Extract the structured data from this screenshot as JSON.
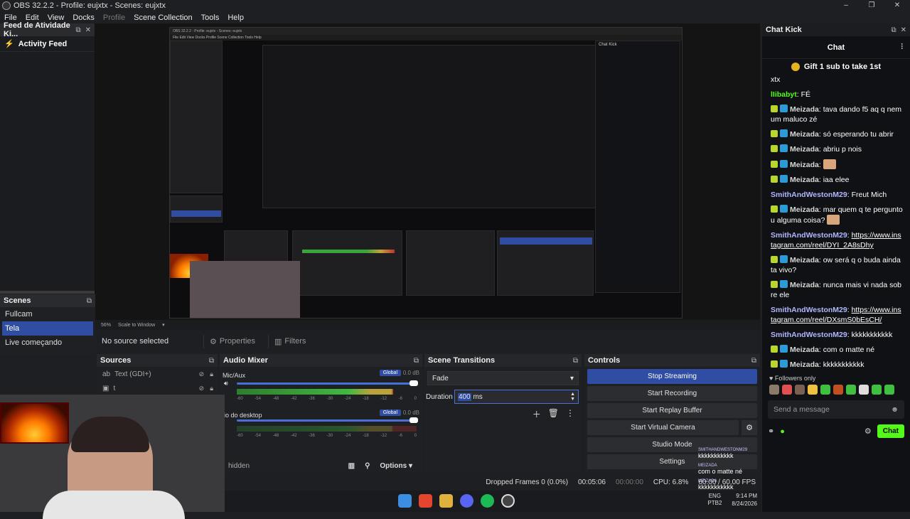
{
  "window": {
    "title": "OBS 32.2.2 - Profile: eujxtx - Scenes: eujxtx",
    "controls": [
      "–",
      "❐",
      "✕"
    ]
  },
  "menu": [
    "File",
    "Edit",
    "View",
    "Docks",
    "Profile",
    "Scene Collection",
    "Tools",
    "Help"
  ],
  "activity_dock": {
    "title": "Feed de Atividade Ki...",
    "header": "Activity Feed"
  },
  "scenes": {
    "title": "Scenes",
    "items": [
      "Fullcam",
      "Tela",
      "Live começando"
    ],
    "selected": "Tela"
  },
  "preview": {
    "zoom": "56%",
    "scale_mode": "Scale to Window",
    "nested_title": "OBS 32.2.2 - Profile: eujxtx - Scenes: eujxtx",
    "nested_menu": "File   Edit   View   Docks   Profile   Scene Collection   Tools   Help"
  },
  "context_bar": {
    "no_source": "No source selected",
    "properties": "Properties",
    "filters": "Filters"
  },
  "sources": {
    "title": "Sources",
    "items": [
      {
        "icon": "text-icon",
        "label": "Text (GDI+)"
      },
      {
        "icon": "image-icon",
        "label": "t"
      }
    ]
  },
  "mixer": {
    "title": "Audio Mixer",
    "channels": [
      {
        "name": "Mic/Aux",
        "db": "0.0 dB",
        "tag": "Global",
        "level": 0.87
      },
      {
        "name": "lio do desktop",
        "db": "0.0 dB",
        "tag": "Global",
        "level": 0.0
      }
    ],
    "scale": [
      "-60",
      "-54",
      "-48",
      "-42",
      "-36",
      "-30",
      "-24",
      "-18",
      "-12",
      "-6",
      "0"
    ],
    "bottom_label": "hidden",
    "options": "Options"
  },
  "transitions": {
    "title": "Scene Transitions",
    "selected": "Fade",
    "duration_label": "Duration",
    "duration_value": "400",
    "duration_unit": "ms"
  },
  "controls": {
    "title": "Controls",
    "buttons": [
      "Stop Streaming",
      "Start Recording",
      "Start Replay Buffer",
      "Start Virtual Camera",
      "Studio Mode",
      "Settings"
    ]
  },
  "status": {
    "dropped": "Dropped Frames 0 (0.0%)",
    "time": "00:05:06",
    "rec_time": "00:00:00",
    "cpu": "CPU: 6.8%",
    "fps": "60.00 / 60.00 FPS"
  },
  "overlay_chat": [
    {
      "user": "SMITHANDWESTONM29",
      "text": "kkkkkkkkkkk"
    },
    {
      "user": "MEIZADA",
      "text": "com o matte né"
    },
    {
      "user": "MEIZADA",
      "text": "kkkkkkkkkkk"
    }
  ],
  "taskbar": {
    "lang": "ENG",
    "kbd": "PTB2",
    "time": "9:14 PM",
    "date": "8/24/2026"
  },
  "chat": {
    "dock_title": "Chat Kick",
    "header": "Chat",
    "gift_text": "Gift 1 sub to take 1st",
    "messages": [
      {
        "user": "",
        "text": "xtx",
        "style": "plain",
        "badges": 0
      },
      {
        "user": "lIibabyt",
        "text": "FÉ",
        "style": "green",
        "badges": 0
      },
      {
        "user": "Meizada",
        "text": "tava dando f5 aq q nem um maluco zé",
        "style": "plain",
        "badges": 2
      },
      {
        "user": "Meizada",
        "text": "só esperando tu abrir",
        "style": "plain",
        "badges": 2
      },
      {
        "user": "Meizada",
        "text": "abriu p nois",
        "style": "plain",
        "badges": 2
      },
      {
        "user": "Meizada",
        "text": "",
        "style": "plain",
        "badges": 2,
        "emote": true
      },
      {
        "user": "Meizada",
        "text": "iaa elee",
        "style": "plain",
        "badges": 2
      },
      {
        "user": "SmithAndWestonM29",
        "text": "Freut Mich",
        "style": "blue",
        "badges": 0
      },
      {
        "user": "Meizada",
        "text": "mar quem q te perguntou alguma coisa?",
        "style": "plain",
        "badges": 2,
        "emote": true
      },
      {
        "user": "SmithAndWestonM29",
        "text": "https://www.instagram.com/reel/DYI_2A8sDhy",
        "style": "blue",
        "badges": 0,
        "link": true
      },
      {
        "user": "Meizada",
        "text": "ow será q o buda ainda ta vivo?",
        "style": "plain",
        "badges": 2
      },
      {
        "user": "Meizada",
        "text": "nunca mais vi nada sobre ele",
        "style": "plain",
        "badges": 2
      },
      {
        "user": "SmithAndWestonM29",
        "text": "https://www.instagram.com/reel/DXsmS0bEsCH/",
        "style": "blue",
        "badges": 0,
        "link": true
      },
      {
        "user": "SmithAndWestonM29",
        "text": "kkkkkkkkkkk",
        "style": "blue",
        "badges": 0
      },
      {
        "user": "Meizada",
        "text": "com o matte né",
        "style": "plain",
        "badges": 2
      },
      {
        "user": "Meizada",
        "text": "kkkkkkkkkkk",
        "style": "plain",
        "badges": 2
      }
    ],
    "followers_only": "Followers only",
    "send_placeholder": "Send a message",
    "chat_button": "Chat"
  }
}
